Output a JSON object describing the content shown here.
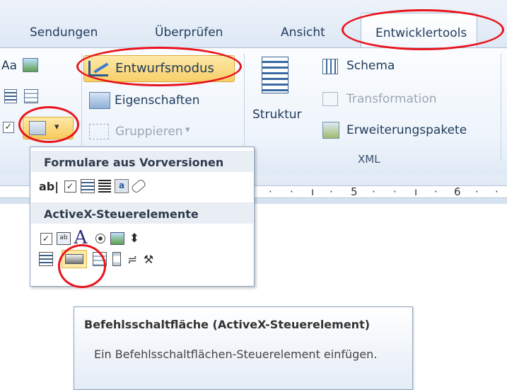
{
  "tabs": [
    "Sendungen",
    "Überprüfen",
    "Ansicht",
    "Entwicklertools"
  ],
  "ribbon": {
    "aa_label": "Aa",
    "design_mode": "Entwurfsmodus",
    "properties": "Eigenschaften",
    "group": "Gruppieren",
    "group_arrow": "▾",
    "structure": "Struktur",
    "schema": "Schema",
    "transformation": "Transformation",
    "expansion_packs": "Erweiterungspakete",
    "xml_group": "XML"
  },
  "ruler": {
    "marks": [
      "5",
      "6"
    ]
  },
  "dropdown": {
    "legacy_header": "Formulare aus Vorversionen",
    "activex_header": "ActiveX-Steuerelemente",
    "legacy_text_glyph": "ab|",
    "activex_label_glyph": "A"
  },
  "tooltip": {
    "title": "Befehlsschaltfläche (ActiveX-Steuerelement)",
    "body": "Ein Befehlsschaltflächen-Steuerelement einfügen."
  },
  "colors": {
    "annotation": "#e8141c",
    "highlight": "#fbd86e"
  }
}
